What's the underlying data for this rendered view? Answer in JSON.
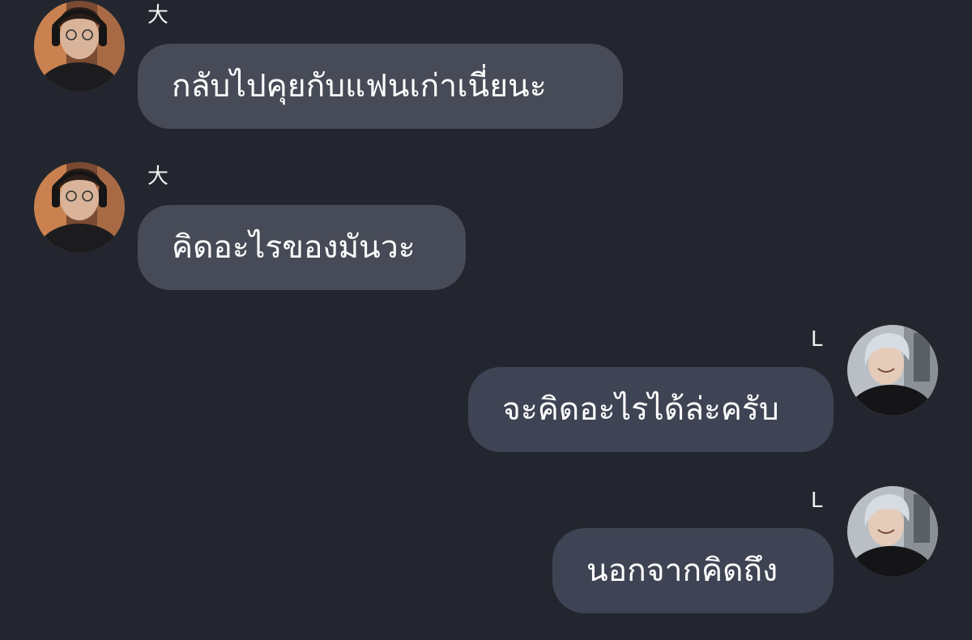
{
  "messages": [
    {
      "sender": "大",
      "text": "กลับไปคุยกับแฟนเก่าเนี่ยนะ",
      "side": "left",
      "avatar": "dark-hair-headphones-avatar"
    },
    {
      "sender": "大",
      "text": "คิดอะไรของมันวะ",
      "side": "left",
      "avatar": "dark-hair-headphones-avatar"
    },
    {
      "sender": "L",
      "text": "จะคิดอะไรได้ล่ะครับ",
      "side": "right",
      "avatar": "silver-hair-avatar"
    },
    {
      "sender": "L",
      "text": "นอกจากคิดถึง",
      "side": "right",
      "avatar": "silver-hair-avatar"
    }
  ],
  "colors": {
    "background": "#23262e",
    "bubble_incoming": "#474b57",
    "bubble_outgoing": "#3f4454",
    "text": "#ffffff"
  }
}
